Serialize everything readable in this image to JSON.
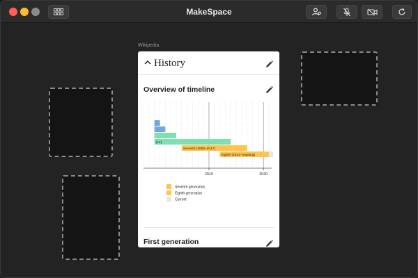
{
  "window": {
    "title": "MakeSpace"
  },
  "source": {
    "label": "Wikipedia"
  },
  "article": {
    "section_title": "History",
    "subsection_title": "Overview of timeline",
    "next_section_title": "First generation"
  },
  "timeline": {
    "bars": [
      {
        "label": "",
        "start": 2000,
        "end": 2001,
        "color": "#6fa8dc"
      },
      {
        "label": "",
        "start": 2000,
        "end": 2002,
        "color": "#6fa8dc"
      },
      {
        "label": "",
        "start": 2000,
        "end": 2004,
        "color": "#7ee0b0"
      },
      {
        "label": "(12)",
        "start": 2000,
        "end": 2014,
        "color": "#7ee0b0"
      },
      {
        "label": "Seventh (2005–2017)",
        "start": 2005,
        "end": 2017,
        "color": "#ffc44d"
      },
      {
        "label": "Eighth (2012–ongoing)",
        "start": 2012,
        "end": 2021,
        "color": "#ffc44d"
      }
    ],
    "axis_ticks": [
      "2010",
      "2020"
    ],
    "legend": [
      {
        "label": "Seventh generation",
        "color": "#ffc44d"
      },
      {
        "label": "Eighth generation",
        "color": "#ffc44d"
      },
      {
        "label": "Current",
        "color": "#e6e6e6"
      }
    ]
  }
}
